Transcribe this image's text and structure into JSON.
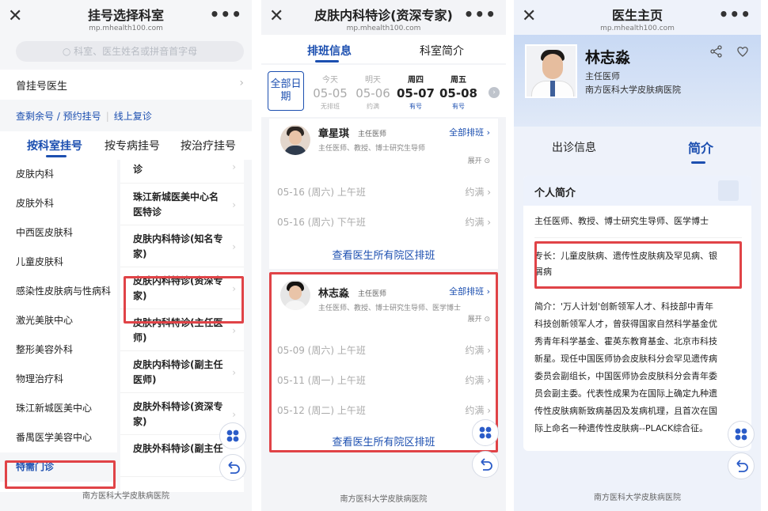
{
  "panel1": {
    "header": {
      "title": "挂号选择科室",
      "url": "mp.mhealth100.com"
    },
    "search_placeholder": "科室、医生姓名或拼音首字母",
    "doctor_row": {
      "label": "曾挂号医生"
    },
    "links": {
      "slots": "查剩余号 / 预约挂号",
      "online": "线上复诊"
    },
    "tabs": [
      "按科室挂号",
      "按专病挂号",
      "按治疗挂号"
    ],
    "departments": [
      "皮肤内科",
      "皮肤外科",
      "中西医皮肤科",
      "儿童皮肤科",
      "感染性皮肤病与性病科",
      "激光美肤中心",
      "整形美容外科",
      "物理治疗科",
      "珠江新城医美中心",
      "番禺医学美容中心",
      "特需门诊"
    ],
    "clinics": [
      "诊",
      "珠江新城医美中心名医特诊",
      "皮肤内科特诊(知名专家)",
      "皮肤内科特诊(资深专家)",
      "皮肤内科特诊(主任医师)",
      "皮肤内科特诊(副主任医师)",
      "皮肤外科特诊(资深专家)",
      "皮肤外科特诊(副主任"
    ],
    "footer": "南方医科大学皮肤病医院"
  },
  "panel2": {
    "header": {
      "title": "皮肤内科特诊(资深专家)",
      "url": "mp.mhealth100.com"
    },
    "tabs": [
      "排班信息",
      "科室简介"
    ],
    "all_dates": "全部日期",
    "dates": [
      {
        "week": "今天",
        "date": "05-05",
        "status": "无排班"
      },
      {
        "week": "明天",
        "date": "05-06",
        "status": "约满"
      },
      {
        "week": "周四",
        "date": "05-07",
        "status": "有号"
      },
      {
        "week": "周五",
        "date": "05-08",
        "status": "有号"
      }
    ],
    "doctors": [
      {
        "name": "章星琪",
        "title": "主任医师",
        "desc": "主任医师、教授、博士研究生导师",
        "all": "全部排班",
        "expand": "展开",
        "slots": [
          {
            "time": "05-16 (周六)  上午班",
            "status": "约满"
          },
          {
            "time": "05-16 (周六)  下午班",
            "status": "约满"
          }
        ],
        "view_all": "查看医生所有院区排班"
      },
      {
        "name": "林志淼",
        "title": "主任医师",
        "desc": "主任医师、教授、博士研究生导师、医学博士",
        "all": "全部排班",
        "expand": "展开",
        "slots": [
          {
            "time": "05-09 (周六)  上午班",
            "status": "约满"
          },
          {
            "time": "05-11 (周一)  上午班",
            "status": "约满"
          },
          {
            "time": "05-12 (周二)  上午班",
            "status": "约满"
          }
        ],
        "view_all": "查看医生所有院区排班"
      }
    ],
    "footer": "南方医科大学皮肤病医院"
  },
  "panel3": {
    "header": {
      "title": "医生主页",
      "url": "mp.mhealth100.com"
    },
    "name": "林志淼",
    "title": "主任医师",
    "hospital": "南方医科大学皮肤病医院",
    "tabs": [
      "出诊信息",
      "简介"
    ],
    "card_title": "个人简介",
    "summary": "主任医师、教授、博士研究生导师、医学博士",
    "specialty_l1": "专长：儿童皮肤病、遗传性皮肤病及罕见病、银",
    "specialty_l2": "屑病",
    "bio": [
      "简介：'万人计划'创新领军人才、科技部中青年",
      "科技创新领军人才，曾获得国家自然科学基金优",
      "秀青年科学基金、霍英东教育基金、北京市科技",
      "新星。现任中国医师协会皮肤科分会罕见遗传病",
      "委员会副组长，中国医师协会皮肤科分会青年委",
      "员会副主委。代表性成果为在国际上确定九种遗",
      "传性皮肤病新致病基因及发病机理，且首次在国",
      "际上命名一种遗传性皮肤病--PLACK综合征。"
    ],
    "footer": "南方医科大学皮肤病医院"
  },
  "icons": {
    "close": "close-icon",
    "more": "more-icon",
    "share": "share-icon",
    "heart": "heart-icon",
    "apps": "apps-icon",
    "back": "back-icon"
  },
  "colors": {
    "accent": "#1c4fb0",
    "highlight": "#e04347"
  }
}
